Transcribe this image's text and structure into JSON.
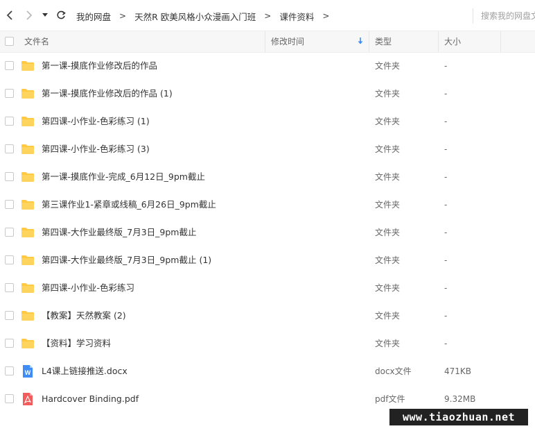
{
  "toolbar": {
    "breadcrumb": [
      "我的网盘",
      "天然R 欧美风格小众漫画入门班",
      "课件资料"
    ],
    "separator": ">",
    "search_placeholder": "搜索我的网盘文件"
  },
  "table": {
    "columns": {
      "name": "文件名",
      "modified": "修改时间",
      "type": "类型",
      "size": "大小"
    },
    "sort_column": "modified",
    "rows": [
      {
        "icon": "folder-icon",
        "name": "第一课-摸底作业修改后的作品",
        "type": "文件夹",
        "size": "-"
      },
      {
        "icon": "folder-icon",
        "name": "第一课-摸底作业修改后的作品 (1)",
        "type": "文件夹",
        "size": "-"
      },
      {
        "icon": "folder-icon",
        "name": "第四课-小作业-色彩练习 (1)",
        "type": "文件夹",
        "size": "-"
      },
      {
        "icon": "folder-icon",
        "name": "第四课-小作业-色彩练习 (3)",
        "type": "文件夹",
        "size": "-"
      },
      {
        "icon": "folder-icon",
        "name": "第一课-摸底作业-完成_6月12日_9pm截止",
        "type": "文件夹",
        "size": "-"
      },
      {
        "icon": "folder-icon",
        "name": "第三课作业1-紧章或线稿_6月26日_9pm截止",
        "type": "文件夹",
        "size": "-"
      },
      {
        "icon": "folder-icon",
        "name": "第四课-大作业最终版_7月3日_9pm截止",
        "type": "文件夹",
        "size": "-"
      },
      {
        "icon": "folder-icon",
        "name": "第四课-大作业最终版_7月3日_9pm截止 (1)",
        "type": "文件夹",
        "size": "-"
      },
      {
        "icon": "folder-icon",
        "name": "第四课-小作业-色彩练习",
        "type": "文件夹",
        "size": "-"
      },
      {
        "icon": "folder-icon",
        "name": "【教案】天然教案 (2)",
        "type": "文件夹",
        "size": "-"
      },
      {
        "icon": "folder-icon",
        "name": "【资料】学习资料",
        "type": "文件夹",
        "size": "-"
      },
      {
        "icon": "word-doc-icon",
        "name": "L4课上链接推送.docx",
        "type": "docx文件",
        "size": "471KB"
      },
      {
        "icon": "pdf-icon",
        "name": "Hardcover Binding.pdf",
        "type": "pdf文件",
        "size": "9.32MB"
      }
    ]
  },
  "watermark": "www.tiaozhuan.net",
  "colors": {
    "folder": "#FFC940",
    "word": "#3F8CF5",
    "pdf": "#F25C5C",
    "sort_accent": "#3B8BF5"
  }
}
